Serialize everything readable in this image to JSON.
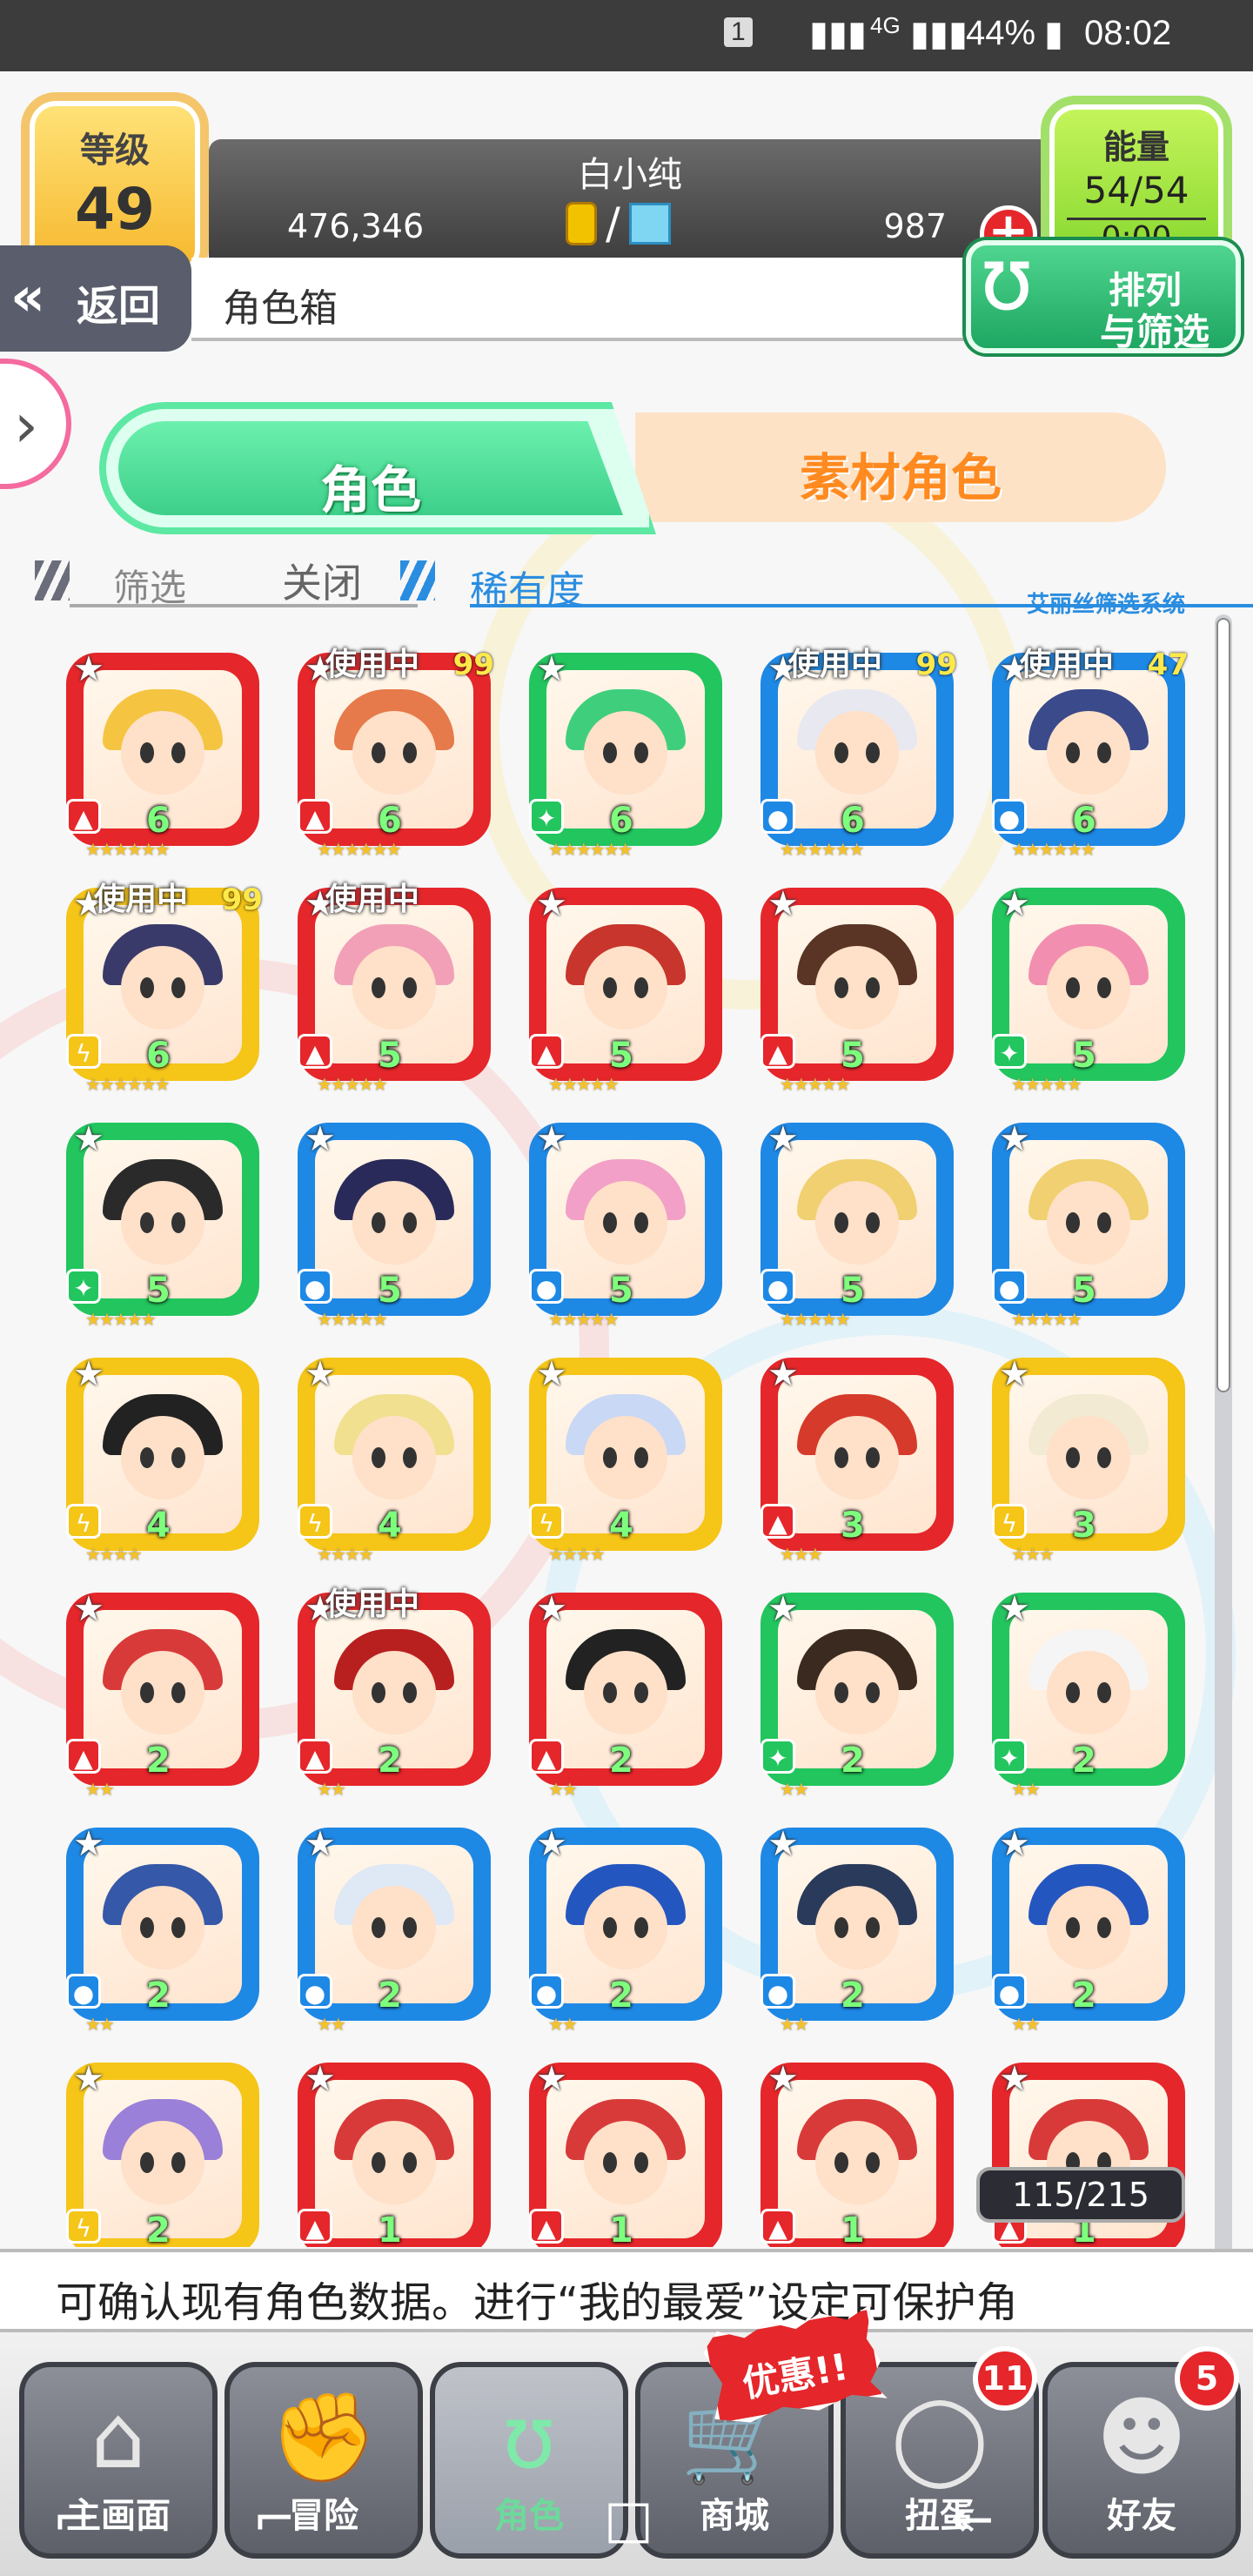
{
  "status_bar": {
    "sim": "1",
    "network": "4G",
    "battery": "44%",
    "time": "08:02"
  },
  "header": {
    "level_label": "等级",
    "level_value": "49",
    "player_name": "白小纯",
    "gold": "476,346",
    "gems": "987",
    "currency_separator": "/",
    "energy_label": "能量",
    "energy_value": "54/54",
    "energy_timer": "0:00"
  },
  "nav": {
    "back_label": "返回",
    "breadcrumb": "角色箱",
    "sort_label_1": "排列",
    "sort_label_2": "与筛选"
  },
  "tabs": {
    "characters": "角色",
    "materials": "素材角色"
  },
  "filter": {
    "filter_label": "筛选",
    "filter_state": "关闭",
    "sort_key": "稀有度",
    "system_name": "艾丽丝筛选系统"
  },
  "in_use_label": "使用中",
  "character_count": "115/215",
  "info_text": "可确认现有角色数据。进行“我的最爱”设定可保护角",
  "promo_label": "优惠!!",
  "bottom_nav": [
    {
      "label": "主画面",
      "icon": "home-icon"
    },
    {
      "label": "冒险",
      "icon": "handshake-icon"
    },
    {
      "label": "角色",
      "icon": "rabbit-icon"
    },
    {
      "label": "商城",
      "icon": "cart-icon"
    },
    {
      "label": "扭蛋",
      "icon": "egg-icon",
      "badge": "11"
    },
    {
      "label": "好友",
      "icon": "friends-icon",
      "badge": "5"
    }
  ],
  "colors": {
    "fire": "#e5262a",
    "water": "#1e88e5",
    "wood": "#22c55e",
    "thunder": "#f5c518"
  },
  "characters": [
    {
      "element": "fire",
      "level": "6",
      "stars": 6
    },
    {
      "element": "fire",
      "level": "6",
      "stars": 6,
      "in_use": true,
      "lv_tag": "99"
    },
    {
      "element": "wood",
      "level": "6",
      "stars": 6
    },
    {
      "element": "water",
      "level": "6",
      "stars": 6,
      "in_use": true,
      "lv_tag": "99"
    },
    {
      "element": "water",
      "level": "6",
      "stars": 6,
      "in_use": true,
      "lv_tag": "47"
    },
    {
      "element": "thunder",
      "level": "6",
      "stars": 6,
      "in_use": true,
      "lv_tag": "99"
    },
    {
      "element": "fire",
      "level": "5",
      "stars": 5,
      "in_use": true
    },
    {
      "element": "fire",
      "level": "5",
      "stars": 5
    },
    {
      "element": "fire",
      "level": "5",
      "stars": 5
    },
    {
      "element": "wood",
      "level": "5",
      "stars": 5
    },
    {
      "element": "wood",
      "level": "5",
      "stars": 5
    },
    {
      "element": "water",
      "level": "5",
      "stars": 5
    },
    {
      "element": "water",
      "level": "5",
      "stars": 5
    },
    {
      "element": "water",
      "level": "5",
      "stars": 5
    },
    {
      "element": "water",
      "level": "5",
      "stars": 5
    },
    {
      "element": "thunder",
      "level": "4",
      "stars": 4
    },
    {
      "element": "thunder",
      "level": "4",
      "stars": 4
    },
    {
      "element": "thunder",
      "level": "4",
      "stars": 4
    },
    {
      "element": "fire",
      "level": "3",
      "stars": 3
    },
    {
      "element": "thunder",
      "level": "3",
      "stars": 3
    },
    {
      "element": "fire",
      "level": "2",
      "stars": 2
    },
    {
      "element": "fire",
      "level": "2",
      "stars": 2,
      "in_use": true
    },
    {
      "element": "fire",
      "level": "2",
      "stars": 2
    },
    {
      "element": "wood",
      "level": "2",
      "stars": 2
    },
    {
      "element": "wood",
      "level": "2",
      "stars": 2
    },
    {
      "element": "water",
      "level": "2",
      "stars": 2
    },
    {
      "element": "water",
      "level": "2",
      "stars": 2
    },
    {
      "element": "water",
      "level": "2",
      "stars": 2
    },
    {
      "element": "water",
      "level": "2",
      "stars": 2
    },
    {
      "element": "water",
      "level": "2",
      "stars": 2
    },
    {
      "element": "thunder",
      "level": "2",
      "stars": 2
    },
    {
      "element": "fire",
      "level": "1",
      "stars": 1
    },
    {
      "element": "fire",
      "level": "1",
      "stars": 1
    },
    {
      "element": "fire",
      "level": "1",
      "stars": 1
    },
    {
      "element": "fire",
      "level": "1",
      "stars": 1
    }
  ]
}
